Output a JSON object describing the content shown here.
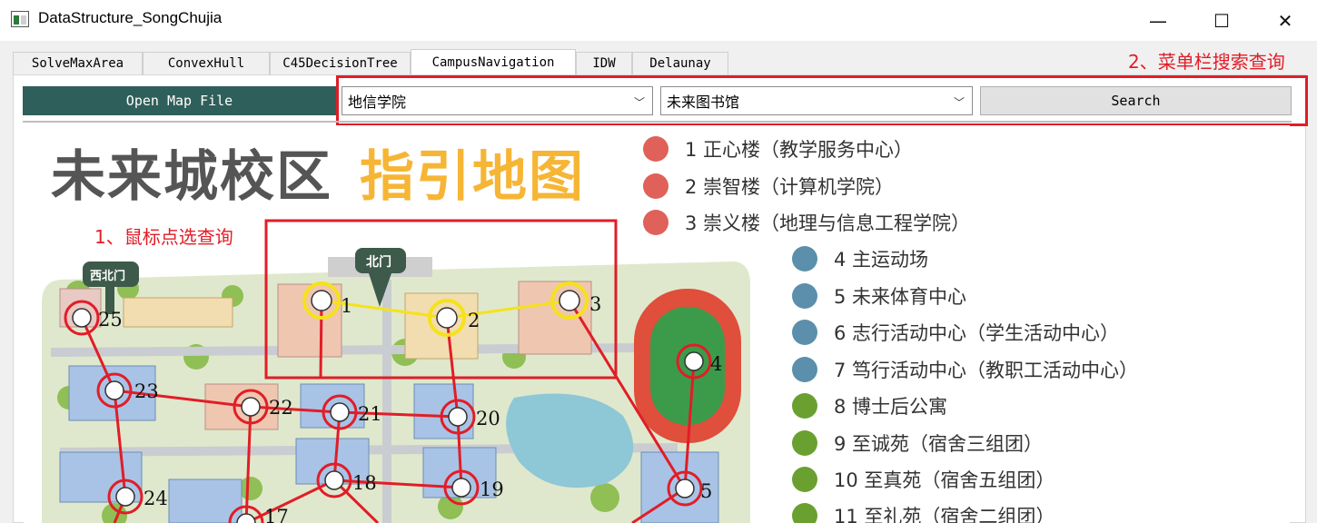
{
  "window": {
    "title": "DataStructure_SongChujia",
    "minimize": "—",
    "maximize": "☐",
    "close": "✕"
  },
  "tabs": [
    "SolveMaxArea",
    "ConvexHull",
    "C45DecisionTree",
    "CampusNavigation",
    "IDW",
    "Delaunay"
  ],
  "active_tab": "CampusNavigation",
  "toolbar": {
    "open_label": "Open Map File",
    "from_value": "地信学院",
    "to_value": "未来图书馆",
    "search_label": "Search"
  },
  "annotations": {
    "menu_search": "2、菜单栏搜索查询",
    "mouse_select": "1、鼠标点选查询"
  },
  "map": {
    "title_part1": "未来城校区",
    "title_part2": "指引地图",
    "north_gate": "北门",
    "northwest_gate": "西北门",
    "legend": [
      {
        "text": "1 正心楼（教学服务中心）",
        "color": "#e0605a"
      },
      {
        "text": "2 崇智楼（计算机学院）",
        "color": "#e0605a"
      },
      {
        "text": "3 崇义楼（地理与信息工程学院）",
        "color": "#e0605a"
      },
      {
        "text": "4 主运动场",
        "color": "#5b8fab"
      },
      {
        "text": "5 未来体育中心",
        "color": "#5b8fab"
      },
      {
        "text": "6 志行活动中心（学生活动中心）",
        "color": "#5b8fab"
      },
      {
        "text": "7 笃行活动中心（教职工活动中心）",
        "color": "#5b8fab"
      },
      {
        "text": "8 博士后公寓",
        "color": "#6aa030"
      },
      {
        "text": "9 至诚苑（宿舍三组团）",
        "color": "#6aa030"
      },
      {
        "text": "10 至真苑（宿舍五组团）",
        "color": "#6aa030"
      },
      {
        "text": "11 至礼苑（宿舍二组团）",
        "color": "#6aa030"
      }
    ],
    "nodes": [
      "1",
      "2",
      "3",
      "4",
      "5",
      "17",
      "18",
      "19",
      "20",
      "21",
      "22",
      "23",
      "24",
      "25"
    ]
  }
}
